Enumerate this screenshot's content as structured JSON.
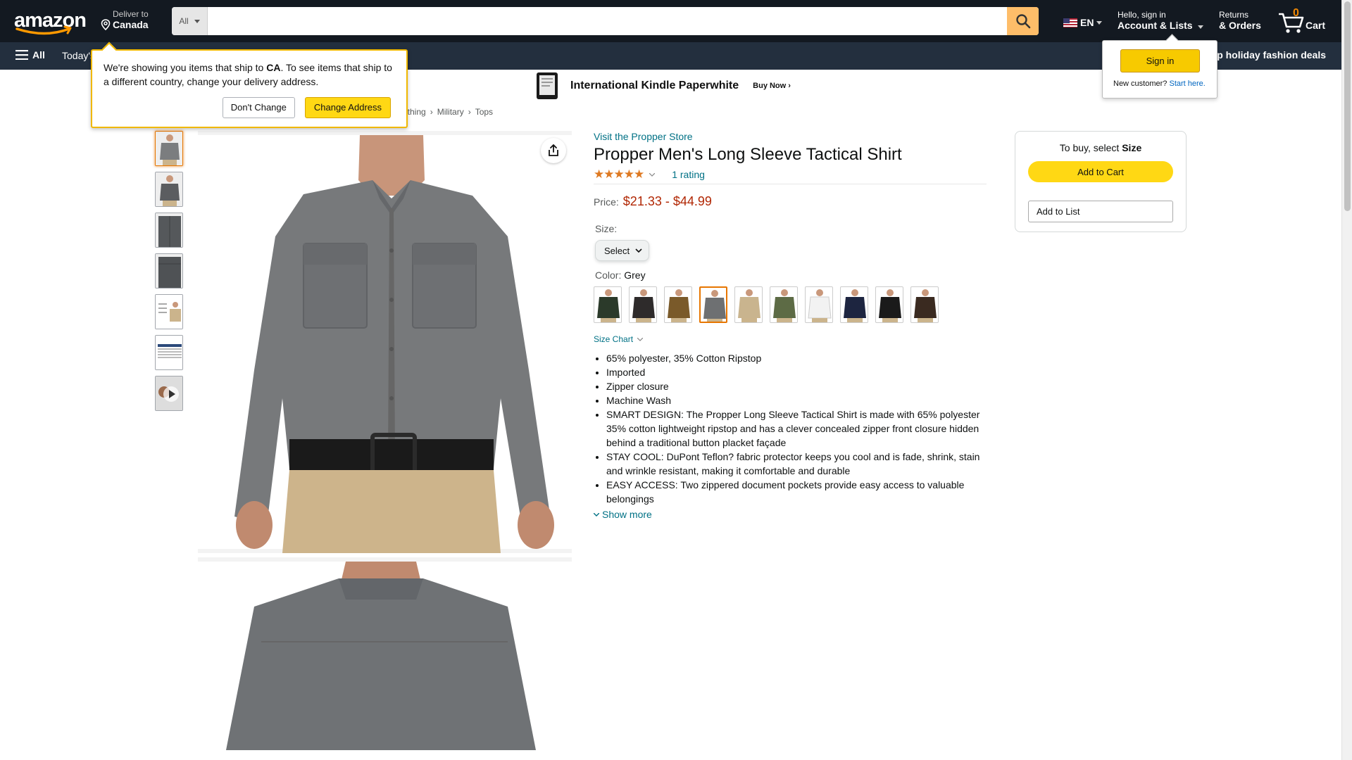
{
  "header": {
    "logo_text": "amazon",
    "deliver_line1": "Deliver to",
    "deliver_line2": "Canada",
    "search_category": "All",
    "search_placeholder": "",
    "lang": "EN",
    "account_line1": "Hello, sign in",
    "account_line2": "Account & Lists",
    "returns_line1": "Returns",
    "returns_line2": "& Orders",
    "cart_count": "0",
    "cart_label": "Cart"
  },
  "subnav": {
    "all_label": "All",
    "today_label": "Today's",
    "deal_label": "p holiday fashion deals"
  },
  "address_popover": {
    "text_pre": "We're showing you items that ship to ",
    "country": "CA",
    "text_post": ". To see items that ship to a different country, change your delivery address.",
    "dont_change": "Don't Change",
    "change_address": "Change Address"
  },
  "signin_popover": {
    "button": "Sign in",
    "new_customer": "New customer?",
    "start_here": "Start here."
  },
  "banner": {
    "title": "International Kindle Paperwhite",
    "cta": "Buy Now ›"
  },
  "breadcrumb": [
    "othing",
    "›",
    "Military",
    "›",
    "Tops"
  ],
  "product": {
    "store_link": "Visit the Propper Store",
    "title": "Propper Men's Long Sleeve Tactical Shirt",
    "stars": "★★★★★",
    "rating_value": 5,
    "rating_text": "1 rating",
    "price_label": "Price:",
    "price": "$21.33 - $44.99",
    "size_label": "Size:",
    "size_value": "Select",
    "color_label": "Color:",
    "color_value": "Grey",
    "swatch_colors": [
      "#2b3a2a",
      "#2e2b2b",
      "#7a5a2a",
      "#6e7072",
      "#c9b48e",
      "#5d6b45",
      "#f2f2f2",
      "#1d2540",
      "#1a1a1a",
      "#3a2a20"
    ],
    "selected_swatch": 3,
    "size_chart": "Size Chart",
    "bullets": [
      "65% polyester, 35% Cotton Ripstop",
      "Imported",
      "Zipper closure",
      "Machine Wash",
      "SMART DESIGN: The Propper Long Sleeve Tactical Shirt is made with 65% polyester 35% cotton lightweight ripstop and has a clever concealed zipper front closure hidden behind a traditional button placket façade",
      "STAY COOL: DuPont Teflon? fabric protector keeps you cool and is fade, shrink, stain and wrinkle resistant, making it comfortable and durable",
      "EASY ACCESS: Two zippered document pockets provide easy access to valuable belongings"
    ],
    "show_more": "Show more"
  },
  "buybox": {
    "hint_pre": "To buy, select ",
    "hint_bold": "Size",
    "add_to_cart": "Add to Cart",
    "add_to_list": "Add to List"
  },
  "thumbnails": [
    "shirt-front",
    "shirt-front-dark",
    "shirt-flat",
    "shirt-flat-2",
    "size-guide-model",
    "size-chart-table",
    "video"
  ],
  "colors": {
    "nav_top": "#131921",
    "nav_main": "#232f3e",
    "search_button": "#febd69",
    "price": "#b12704",
    "link": "#007185",
    "accent": "#e77600"
  }
}
